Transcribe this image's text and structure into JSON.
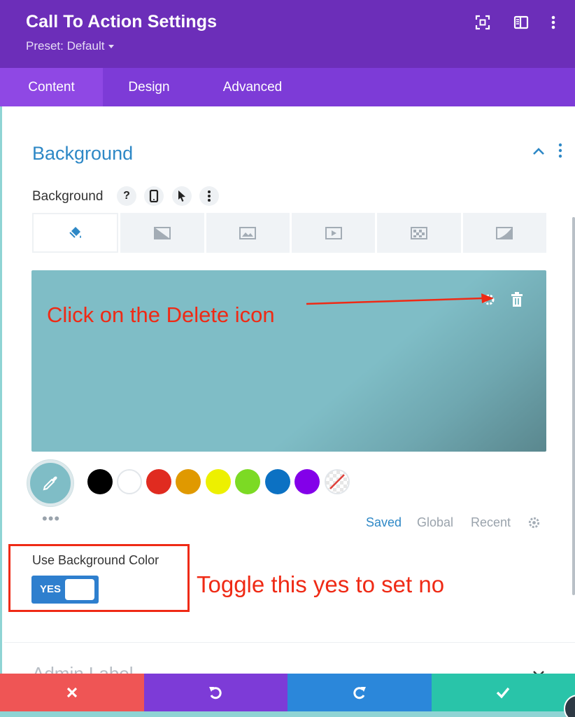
{
  "header": {
    "title": "Call To Action Settings",
    "preset": "Preset: Default",
    "icons": [
      "fullscreen-icon",
      "split-view-icon",
      "more-options-icon"
    ]
  },
  "tabs": [
    {
      "label": "Content",
      "active": true
    },
    {
      "label": "Design",
      "active": false
    },
    {
      "label": "Advanced",
      "active": false
    }
  ],
  "section": {
    "title": "Background",
    "field_label": "Background",
    "label_icons": [
      "help-icon",
      "mobile-icon",
      "hover-icon",
      "more-icon"
    ],
    "type_tabs": [
      "color-icon",
      "gradient-icon",
      "image-icon",
      "video-icon",
      "pattern-icon",
      "mask-icon"
    ],
    "preview_color": "#7fbdc6",
    "preview_icons": [
      "settings-icon",
      "delete-icon"
    ]
  },
  "palette": {
    "swatches": [
      {
        "name": "black",
        "color": "#000000"
      },
      {
        "name": "white",
        "color": "#ffffff"
      },
      {
        "name": "red",
        "color": "#e02b20"
      },
      {
        "name": "orange",
        "color": "#e09900"
      },
      {
        "name": "yellow",
        "color": "#edf000"
      },
      {
        "name": "green",
        "color": "#7cda24"
      },
      {
        "name": "blue",
        "color": "#0c71c3"
      },
      {
        "name": "purple",
        "color": "#8300e9"
      },
      {
        "name": "none",
        "color": "transparent"
      }
    ],
    "tabs": [
      "Saved",
      "Global",
      "Recent"
    ],
    "active_tab": "Saved"
  },
  "toggle": {
    "label": "Use Background Color",
    "value": "YES"
  },
  "annotations": {
    "delete_hint": "Click on the Delete icon",
    "toggle_hint": "Toggle this yes to set no"
  },
  "next_section": {
    "title": "Admin Label"
  },
  "footer": {
    "buttons": [
      "cancel-icon",
      "undo-icon",
      "redo-icon",
      "save-icon"
    ]
  },
  "colors": {
    "header": "#6c2eb9",
    "tabs": "#7d3bd7",
    "accent": "#2e88c6",
    "annotation": "#ef2a15",
    "cancel": "#ef5555",
    "redo": "#2b87da",
    "save": "#29c4a9"
  }
}
